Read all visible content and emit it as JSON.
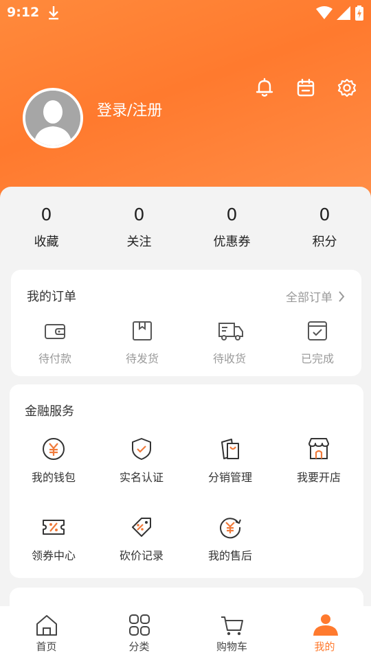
{
  "status_bar": {
    "time": "9:12"
  },
  "profile": {
    "login_text": "登录/注册"
  },
  "stats": [
    {
      "value": "0",
      "label": "收藏"
    },
    {
      "value": "0",
      "label": "关注"
    },
    {
      "value": "0",
      "label": "优惠券"
    },
    {
      "value": "0",
      "label": "积分"
    }
  ],
  "orders": {
    "title": "我的订单",
    "all_label": "全部订单",
    "items": [
      {
        "label": "待付款",
        "icon": "wallet-icon"
      },
      {
        "label": "待发货",
        "icon": "box-icon"
      },
      {
        "label": "待收货",
        "icon": "truck-icon"
      },
      {
        "label": "已完成",
        "icon": "done-icon"
      }
    ]
  },
  "finance": {
    "title": "金融服务",
    "items": [
      {
        "label": "我的钱包",
        "icon": "yuan-icon"
      },
      {
        "label": "实名认证",
        "icon": "shield-check-icon"
      },
      {
        "label": "分销管理",
        "icon": "bags-icon"
      },
      {
        "label": "我要开店",
        "icon": "store-icon"
      },
      {
        "label": "领券中心",
        "icon": "coupon-icon"
      },
      {
        "label": "砍价记录",
        "icon": "price-tag-icon"
      },
      {
        "label": "我的售后",
        "icon": "refund-icon"
      }
    ]
  },
  "tabbar": [
    {
      "label": "首页",
      "icon": "home-icon"
    },
    {
      "label": "分类",
      "icon": "grid-icon"
    },
    {
      "label": "购物车",
      "icon": "cart-icon"
    },
    {
      "label": "我的",
      "icon": "person-icon",
      "active": true
    }
  ],
  "colors": {
    "accent": "#ff7a2e",
    "icon_orange": "#f07a3a",
    "icon_gray": "#555555"
  }
}
